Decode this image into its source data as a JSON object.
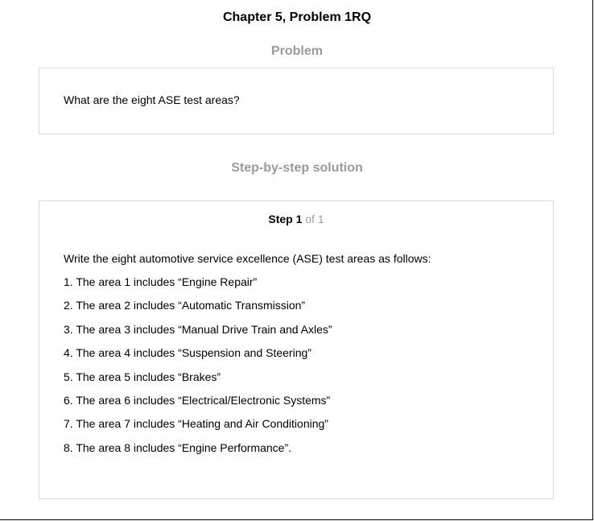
{
  "header": {
    "title": "Chapter 5, Problem 1RQ"
  },
  "problem": {
    "heading": "Problem",
    "text": "What are the eight ASE test areas?"
  },
  "solution": {
    "heading": "Step-by-step solution",
    "step_label": "Step 1",
    "step_count": " of 1",
    "intro": "Write the eight automotive service excellence (ASE) test areas as follows:",
    "areas": [
      "1. The area 1 includes “Engine Repair”",
      "2. The area 2 includes “Automatic Transmission”",
      "3. The area 3 includes “Manual Drive Train and Axles”",
      "4. The area 4 includes “Suspension and Steering”",
      "5. The area 5 includes “Brakes”",
      "6. The area 6 includes “Electrical/Electronic Systems”",
      "7. The area 7 includes “Heating and Air Conditioning”",
      "8. The area 8 includes “Engine Performance”."
    ]
  }
}
